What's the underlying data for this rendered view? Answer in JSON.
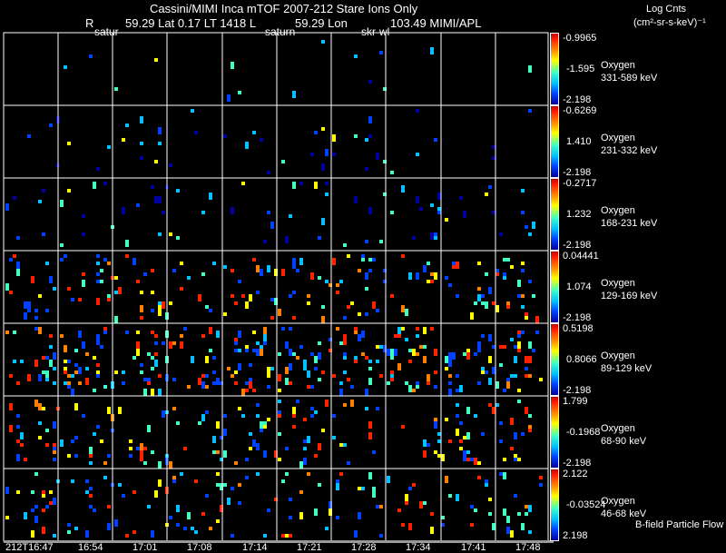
{
  "header": {
    "title": "Cassini/MIMI Inca mTOF  2007-212   Stare   Ions Only",
    "r_label": "R",
    "r_value": "59.29 Lat 0.17 LT 1418 L",
    "l_value": "59.29 Lon",
    "lon_value": "103.49  MIMI/APL",
    "marks": [
      "satur",
      "saturn",
      "skr-wl"
    ],
    "units_line1": "Log Cnts",
    "units_line2": "(cm²-sr-s-keV)⁻¹"
  },
  "chart_data": {
    "type": "heatmap",
    "x_ticks": [
      "212T16:47",
      "16:54",
      "17:01",
      "17:08",
      "17:14",
      "17:21",
      "17:28",
      "17:34",
      "17:41",
      "17:48"
    ],
    "panels": [
      {
        "species": "Oxygen",
        "energy": "331-589 keV",
        "max": "-0.9965",
        "mid": "-1.595",
        "min": "-2.198"
      },
      {
        "species": "Oxygen",
        "energy": "231-332 keV",
        "max": "-0.6269",
        "mid": "1.410",
        "min": "-2.198"
      },
      {
        "species": "Oxygen",
        "energy": "168-231 keV",
        "max": "-0.2717",
        "mid": "1.232",
        "min": "-2.198"
      },
      {
        "species": "Oxygen",
        "energy": "129-169 keV",
        "max": "0.04441",
        "mid": "1.074",
        "min": "-2.198"
      },
      {
        "species": "Oxygen",
        "energy": "89-129 keV",
        "max": "0.5198",
        "mid": "0.8066",
        "min": "-2.198"
      },
      {
        "species": "Oxygen",
        "energy": "68-90 keV",
        "max": "1.799",
        "mid": "-0.1968",
        "min": "-2.198"
      },
      {
        "species": "Oxygen",
        "energy": "46-68 keV",
        "max": "2.122",
        "mid": "-0.03524",
        "min": "2.198"
      }
    ],
    "densities": [
      0.01,
      0.03,
      0.05,
      0.12,
      0.2,
      0.12,
      0.1
    ],
    "colormap": [
      "#0000a0",
      "#0040ff",
      "#00c0ff",
      "#40ffc0",
      "#ffff00",
      "#ff8000",
      "#ff2000"
    ]
  },
  "footer": {
    "bfield": "B-field Particle Flow"
  }
}
